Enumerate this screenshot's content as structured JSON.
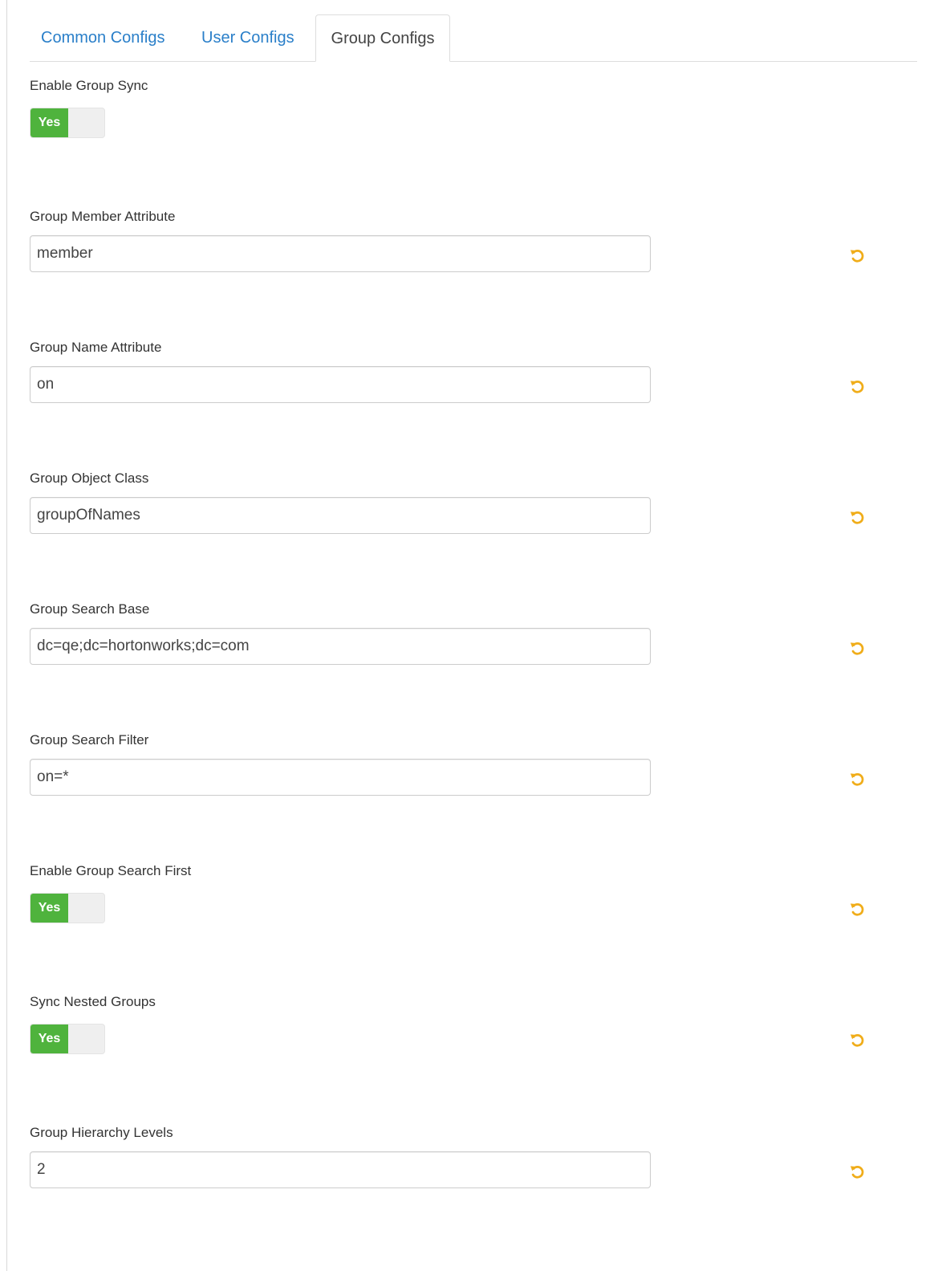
{
  "tabs": {
    "common_label": "Common Configs",
    "user_label": "User Configs",
    "group_label": "Group Configs",
    "active": "Group Configs"
  },
  "fields": {
    "enable_group_sync": {
      "label": "Enable Group Sync",
      "value": "Yes"
    },
    "group_member_attribute": {
      "label": "Group Member Attribute",
      "value": "member"
    },
    "group_name_attribute": {
      "label": "Group Name Attribute",
      "value": "on"
    },
    "group_object_class": {
      "label": "Group Object Class",
      "value": "groupOfNames"
    },
    "group_search_base": {
      "label": "Group Search Base",
      "value": "dc=qe;dc=hortonworks;dc=com"
    },
    "group_search_filter": {
      "label": "Group Search Filter",
      "value": "on=*"
    },
    "enable_group_search_first": {
      "label": "Enable Group Search First",
      "value": "Yes"
    },
    "sync_nested_groups": {
      "label": "Sync Nested Groups",
      "value": "Yes"
    },
    "group_hierarchy_levels": {
      "label": "Group Hierarchy Levels",
      "value": "2"
    }
  },
  "colors": {
    "tab_link": "#2a7fc9",
    "toggle_on": "#4fb33d",
    "undo_icon": "#f0ad1a"
  },
  "icons": {
    "undo": "undo-icon"
  }
}
